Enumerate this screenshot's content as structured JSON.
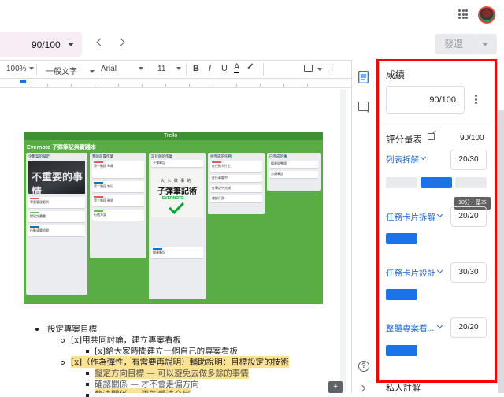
{
  "grade_bar": {
    "grade_value": "90/100",
    "send_label": "發還"
  },
  "toolbar": {
    "zoom": "100%",
    "style": "一般文字",
    "font": "Arial",
    "font_size": "11",
    "bold": "B",
    "italic": "I",
    "underline": "U",
    "text_color": "A"
  },
  "board": {
    "logo": "Trello",
    "title": "Evernote 子彈筆記與實踐本",
    "lists": [
      {
        "title": "企劃案的擬定",
        "cards": [
          "專案管理範例",
          "撰寫計畫書",
          "行動清單追蹤"
        ]
      },
      {
        "title": "我的前置作業",
        "cards": [
          "第一階段 準備",
          "第二階段 執行",
          "第三階段 驗收",
          "行動方案"
        ]
      },
      {
        "title": "設計師的作業",
        "cards": [
          "子彈筆記",
          "搜尋筆記"
        ]
      },
      {
        "title": "待完成的任務",
        "cards": [
          "在任務卡片上",
          "在行事曆中",
          "在筆記中完成",
          "確認任務"
        ]
      },
      {
        "title": "已完成的事",
        "cards": [
          "搜尋與整理",
          "分類筆記"
        ]
      }
    ],
    "photo_caption": "不重要的事情",
    "book_line1": "大 人 做 事 的",
    "book_title": "子彈筆記術",
    "book_brand": "EVERNOTE"
  },
  "doc": {
    "bullets": [
      {
        "text": "設定專案目標"
      },
      {
        "text": "[x]用共同討論，建立專案看板"
      },
      {
        "text": "[x]給大家時間建立一個自己的專案看板"
      },
      {
        "text": "[x]（作為彈性，有需要再說明）輔助說明：目標設定的技術"
      },
      {
        "text": "擬定方向目標 — 可以避免去做多餘的事情"
      },
      {
        "text": "確認關係 — 才不會走偏方向"
      },
      {
        "text": "釐清關係 — 更能看清全局"
      }
    ]
  },
  "panel": {
    "title": "成績",
    "grade": "90/100",
    "rubric_label": "評分量表",
    "rubric_total": "90/100",
    "criteria": [
      {
        "name": "列表拆解",
        "score": "20/30"
      },
      {
        "name": "任務卡片拆解",
        "score": "20/20"
      },
      {
        "name": "任務卡片設計",
        "score": "30/30"
      },
      {
        "name": "整體專案看...",
        "score": "20/20"
      }
    ],
    "tooltip": "10分・基本",
    "next_section": "私人註解"
  },
  "colors": {
    "accent": "#1a73e8",
    "highlight": "#ff0000",
    "board_green": "#5aac44"
  }
}
